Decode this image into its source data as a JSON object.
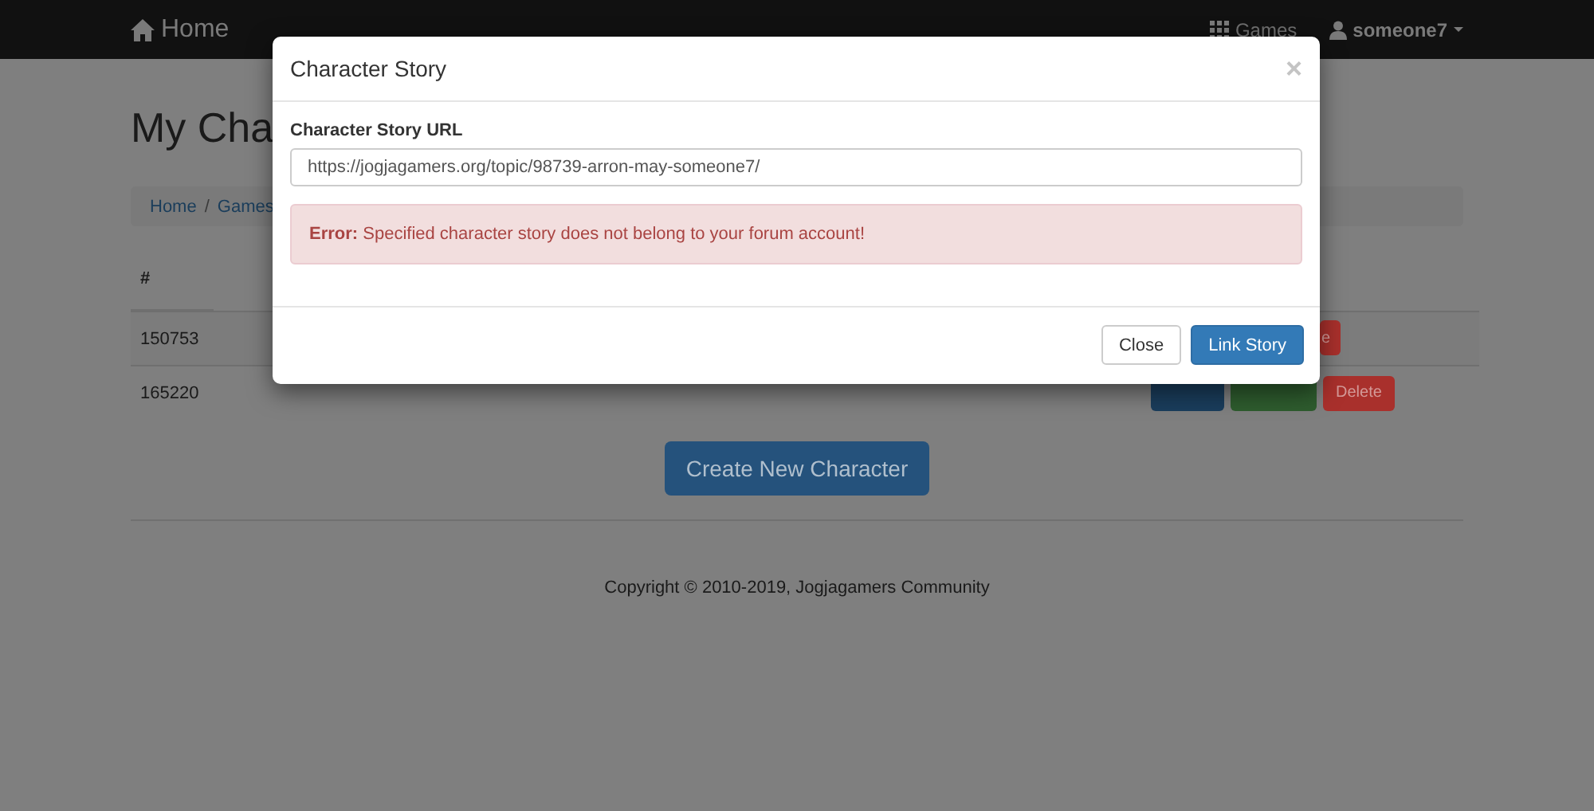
{
  "navbar": {
    "brand": "Home",
    "links": [
      {
        "kind": "games",
        "label": "Games"
      },
      {
        "kind": "user",
        "label": "someone7"
      }
    ]
  },
  "page": {
    "title": "My Cha",
    "breadcrumb": {
      "items": [
        "Home",
        "Games"
      ],
      "separator": "/"
    },
    "table": {
      "columns": [
        "#"
      ],
      "rows": [
        {
          "id": "150753",
          "actions": [
            {
              "kind": "danger",
              "label": "e"
            }
          ]
        },
        {
          "id": "165220",
          "actions": [
            {
              "kind": "primary"
            },
            {
              "kind": "success"
            },
            {
              "kind": "danger",
              "label": "Delete"
            }
          ]
        }
      ]
    },
    "create_button": "Create New Character",
    "footer": "Copyright © 2010-2019, Jogjagamers Community"
  },
  "modal": {
    "title": "Character Story",
    "close": "×",
    "field": {
      "label": "Character Story URL",
      "value": "https://jogjagamers.org/topic/98739-arron-may-someone7/"
    },
    "alert": {
      "kind": "danger",
      "text": "**Error:** Specified character story does not belong to your forum account!"
    },
    "buttons": [
      {
        "kind": "default",
        "label": "Close"
      },
      {
        "kind": "primary",
        "label": "Link Story"
      }
    ]
  }
}
